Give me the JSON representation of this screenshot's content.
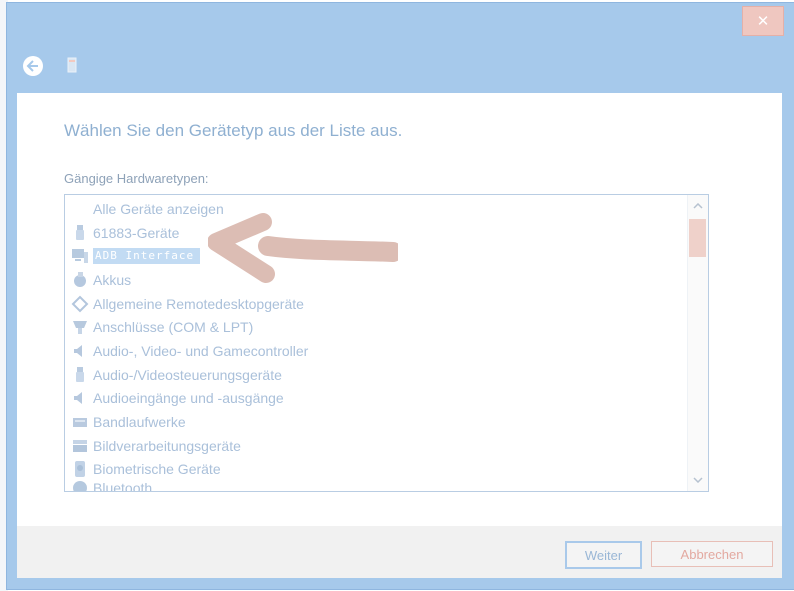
{
  "window": {
    "close_glyph": "✕"
  },
  "heading": "Wählen Sie den Gerätetyp aus der Liste aus.",
  "list_label": "Gängige Hardwaretypen:",
  "list": {
    "items": [
      {
        "label": "Alle Geräte anzeigen",
        "icon": "none"
      },
      {
        "label": "61883-Geräte",
        "icon": "usb-plug-icon"
      },
      {
        "label": "ADB Interface",
        "icon": "computer-icon",
        "selected": true
      },
      {
        "label": "Akkus",
        "icon": "battery-icon"
      },
      {
        "label": "Allgemeine Remotedesktopgeräte",
        "icon": "remote-desktop-icon"
      },
      {
        "label": "Anschlüsse (COM & LPT)",
        "icon": "port-icon"
      },
      {
        "label": "Audio-, Video- und Gamecontroller",
        "icon": "speaker-icon"
      },
      {
        "label": "Audio-/Videosteuerungsgeräte",
        "icon": "usb-plug-icon"
      },
      {
        "label": "Audioeingänge und -ausgänge",
        "icon": "speaker-icon"
      },
      {
        "label": "Bandlaufwerke",
        "icon": "tape-drive-icon"
      },
      {
        "label": "Bildverarbeitungsgeräte",
        "icon": "scanner-icon"
      },
      {
        "label": "Biometrische Geräte",
        "icon": "fingerprint-icon"
      },
      {
        "label": "Bluetooth",
        "icon": "bluetooth-icon",
        "partial": true
      }
    ]
  },
  "buttons": {
    "next": "Weiter",
    "cancel": "Abbrechen"
  },
  "colors": {
    "window_frame": "#a6c9eb",
    "selection": "#c2dbf3",
    "annotation_arrow": "#dcbdb4"
  }
}
